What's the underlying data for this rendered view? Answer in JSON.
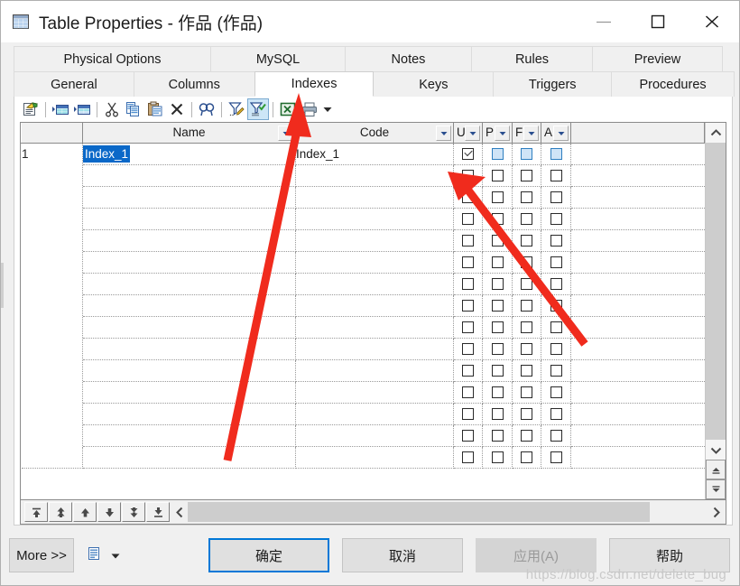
{
  "window": {
    "title": "Table Properties - 作品 (作品)",
    "icon": "table-icon",
    "controls": {
      "minimize": "minimize-icon",
      "maximize": "maximize-icon",
      "close": "close-icon"
    }
  },
  "tabs": {
    "row1": [
      {
        "label": "Physical Options",
        "active": false
      },
      {
        "label": "MySQL",
        "active": false
      },
      {
        "label": "Notes",
        "active": false
      },
      {
        "label": "Rules",
        "active": false
      },
      {
        "label": "Preview",
        "active": false
      }
    ],
    "row2": [
      {
        "label": "General",
        "active": false
      },
      {
        "label": "Columns",
        "active": false
      },
      {
        "label": "Indexes",
        "active": true
      },
      {
        "label": "Keys",
        "active": false
      },
      {
        "label": "Triggers",
        "active": false
      },
      {
        "label": "Procedures",
        "active": false
      }
    ]
  },
  "toolbar": {
    "buttons": [
      {
        "name": "properties-icon",
        "title": "Properties"
      },
      {
        "name": "insert-row-icon",
        "title": "Insert a Row"
      },
      {
        "name": "add-row-icon",
        "title": "Add a Row"
      },
      {
        "name": "cut-icon",
        "title": "Cut"
      },
      {
        "name": "copy-icon",
        "title": "Copy"
      },
      {
        "name": "paste-icon",
        "title": "Paste"
      },
      {
        "name": "delete-icon",
        "title": "Delete"
      },
      {
        "name": "find-icon",
        "title": "Find"
      },
      {
        "name": "filter-edit-icon",
        "title": "Customize Columns and Filter"
      },
      {
        "name": "filter-apply-icon",
        "title": "Apply Filter",
        "selected": true
      },
      {
        "name": "export-excel-icon",
        "title": "Export to Excel"
      },
      {
        "name": "print-icon",
        "title": "Print"
      }
    ],
    "overflow": "chevron-down-icon"
  },
  "grid": {
    "headers": {
      "rownum": "",
      "name": "Name",
      "code": "Code",
      "u": "U",
      "p": "P",
      "f": "F",
      "a": "A"
    },
    "rows": [
      {
        "num": "1",
        "name": "Index_1",
        "name_selected": true,
        "code": "Index_1",
        "u": "checked",
        "p": "blue",
        "f": "blue",
        "a": "blue"
      },
      {
        "num": "",
        "name": "",
        "code": "",
        "u": "empty",
        "p": "empty",
        "f": "empty",
        "a": "empty"
      },
      {
        "num": "",
        "name": "",
        "code": "",
        "u": "empty",
        "p": "empty",
        "f": "empty",
        "a": "empty"
      },
      {
        "num": "",
        "name": "",
        "code": "",
        "u": "empty",
        "p": "empty",
        "f": "empty",
        "a": "empty"
      },
      {
        "num": "",
        "name": "",
        "code": "",
        "u": "empty",
        "p": "empty",
        "f": "empty",
        "a": "empty"
      },
      {
        "num": "",
        "name": "",
        "code": "",
        "u": "empty",
        "p": "empty",
        "f": "empty",
        "a": "empty"
      },
      {
        "num": "",
        "name": "",
        "code": "",
        "u": "empty",
        "p": "empty",
        "f": "empty",
        "a": "empty"
      },
      {
        "num": "",
        "name": "",
        "code": "",
        "u": "empty",
        "p": "empty",
        "f": "empty",
        "a": "empty"
      },
      {
        "num": "",
        "name": "",
        "code": "",
        "u": "empty",
        "p": "empty",
        "f": "empty",
        "a": "empty"
      },
      {
        "num": "",
        "name": "",
        "code": "",
        "u": "empty",
        "p": "empty",
        "f": "empty",
        "a": "empty"
      },
      {
        "num": "",
        "name": "",
        "code": "",
        "u": "empty",
        "p": "empty",
        "f": "empty",
        "a": "empty"
      },
      {
        "num": "",
        "name": "",
        "code": "",
        "u": "empty",
        "p": "empty",
        "f": "empty",
        "a": "empty"
      },
      {
        "num": "",
        "name": "",
        "code": "",
        "u": "empty",
        "p": "empty",
        "f": "empty",
        "a": "empty"
      },
      {
        "num": "",
        "name": "",
        "code": "",
        "u": "empty",
        "p": "empty",
        "f": "empty",
        "a": "empty"
      },
      {
        "num": "",
        "name": "",
        "code": "",
        "u": "empty",
        "p": "empty",
        "f": "empty",
        "a": "empty"
      }
    ],
    "move_buttons": [
      {
        "name": "move-to-top-button",
        "icon": "arrow-top-icon"
      },
      {
        "name": "move-up-fast-button",
        "icon": "arrow-up-double-icon"
      },
      {
        "name": "move-up-button",
        "icon": "arrow-up-icon"
      },
      {
        "name": "move-down-button",
        "icon": "arrow-down-icon"
      },
      {
        "name": "move-down-fast-button",
        "icon": "arrow-down-double-icon"
      },
      {
        "name": "move-to-bottom-button",
        "icon": "arrow-bottom-icon"
      }
    ],
    "vscroll": {
      "up": "chevron-up-icon",
      "down": "chevron-down-icon",
      "page_up": "scroll-page-up-icon",
      "page_down": "scroll-page-down-icon"
    },
    "hscroll": {
      "left": "chevron-left-icon",
      "right": "chevron-right-icon"
    }
  },
  "footer": {
    "more": "More >>",
    "copy_icon": "copy-to-clipboard-icon",
    "copy_dropdown": "chevron-down-icon",
    "ok": "确定",
    "cancel": "取消",
    "apply": "应用(A)",
    "help": "帮助"
  },
  "watermark": "https://blog.csdn.net/delete_bug",
  "colors": {
    "accent": "#0078d7",
    "selection": "#0a68c8",
    "annotation_arrow": "#f02b1d",
    "toolbar_selected": "#cde6f7"
  }
}
